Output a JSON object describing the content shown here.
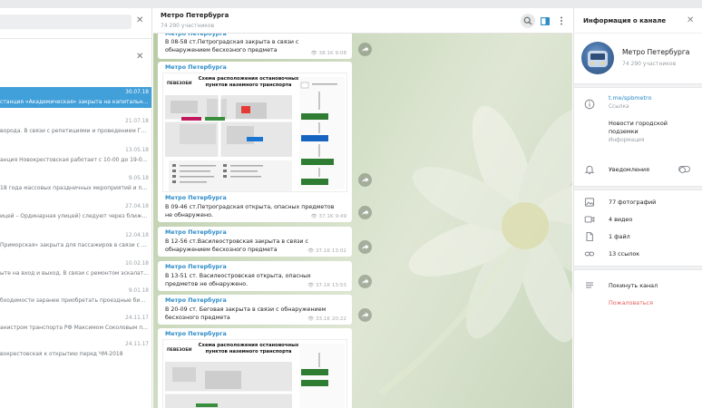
{
  "chat_list": {
    "rows": [
      {
        "date": "30.07.18",
        "text": "станция «Академическая» закрыта на капитальный..."
      },
      {
        "date": "21.07.18",
        "text": "ворода. В связи с репетициями и проведением Главн..."
      },
      {
        "date": "13.05.18",
        "text": "анция Новокрестовская работает с 10-00 до 19-00 ча..."
      },
      {
        "date": "9.05.18",
        "text": "18 года массовых праздничных мероприятий и пров..."
      },
      {
        "date": "27.04.18",
        "text": "ицей – Ординарная улицей) следуют через ближайшу..."
      },
      {
        "date": "12.04.18",
        "text": "Приморская» закрыта для пассажиров в связи с пода..."
      },
      {
        "date": "10.02.18",
        "text": "ыте на вход и выход. В связи с ремонтом эскалат..."
      },
      {
        "date": "9.01.18",
        "text": "бходимости заранее приобретать проездные билеты..."
      },
      {
        "date": "24.11.17",
        "text": "анистром транспорта РФ Максимом Соколовым п..."
      },
      {
        "date": "24.11.17",
        "text": "вокрестовская к открытию перед ЧМ-2018"
      }
    ]
  },
  "chat": {
    "title": "Метро Петербурга",
    "members": "74 290 участников",
    "messages": [
      {
        "author": "Метро Петербурга",
        "text": "В 08-58 ст.Петроградская закрыта в связи с обнаружением бесхозного предмета",
        "views": "38.1K",
        "time": "9:08"
      },
      {
        "author": "Метро Петербурга",
        "text": "В 09-46 ст.Петроградская открыта, опасных предметов не обнаружено.",
        "views": "37.1K",
        "time": "9:49"
      },
      {
        "author": "Метро Петербурга",
        "text": "В 12-56 ст.Василеостровская закрыта в связи с обнаружением бесхозного предмета",
        "views": "37.1K",
        "time": "13:02"
      },
      {
        "author": "Метро Петербурга",
        "text": "В 13-51 ст. Василеостровская открыта, опасных предметов не обнаружено.",
        "views": "37.1K",
        "time": "13:53"
      },
      {
        "author": "Метро Петербурга",
        "text": "В 20-09 ст. Беговая закрыта в связи с обнаружением бесхозного предмета",
        "views": "33.1K",
        "time": "20:22"
      }
    ],
    "photo_posts": [
      {
        "author": "Метро Петербурга",
        "schema_title": "Схема расположения остановочных пунктов наземного транспорта",
        "logo": "ПЕВЕЗОБИ"
      },
      {
        "author": "Метро Петербурга",
        "schema_title": "Схема расположения остановочных пунктов наземного транспорта",
        "logo": "ПЕВЕЗОБИ"
      }
    ]
  },
  "info": {
    "header": "Информация о канале",
    "name": "Метро Петербурга",
    "members": "74 290 участников",
    "link": "t.me/spbmetro",
    "link_label": "Ссылка",
    "description": "Новости городской подземки",
    "description_label": "Информация",
    "notifications": "Уведомления",
    "notifications_on": false,
    "media": [
      {
        "icon": "photo-icon",
        "label": "77 фотографий"
      },
      {
        "icon": "video-icon",
        "label": "4 видео"
      },
      {
        "icon": "file-icon",
        "label": "1 файл"
      },
      {
        "icon": "link-icon",
        "label": "13 ссылок"
      }
    ],
    "leave": "Покинуть канал",
    "report": "Пожаловаться"
  },
  "colors": {
    "accent": "#419fd9",
    "report": "#e35d5d",
    "link": "#2c8bc7"
  }
}
